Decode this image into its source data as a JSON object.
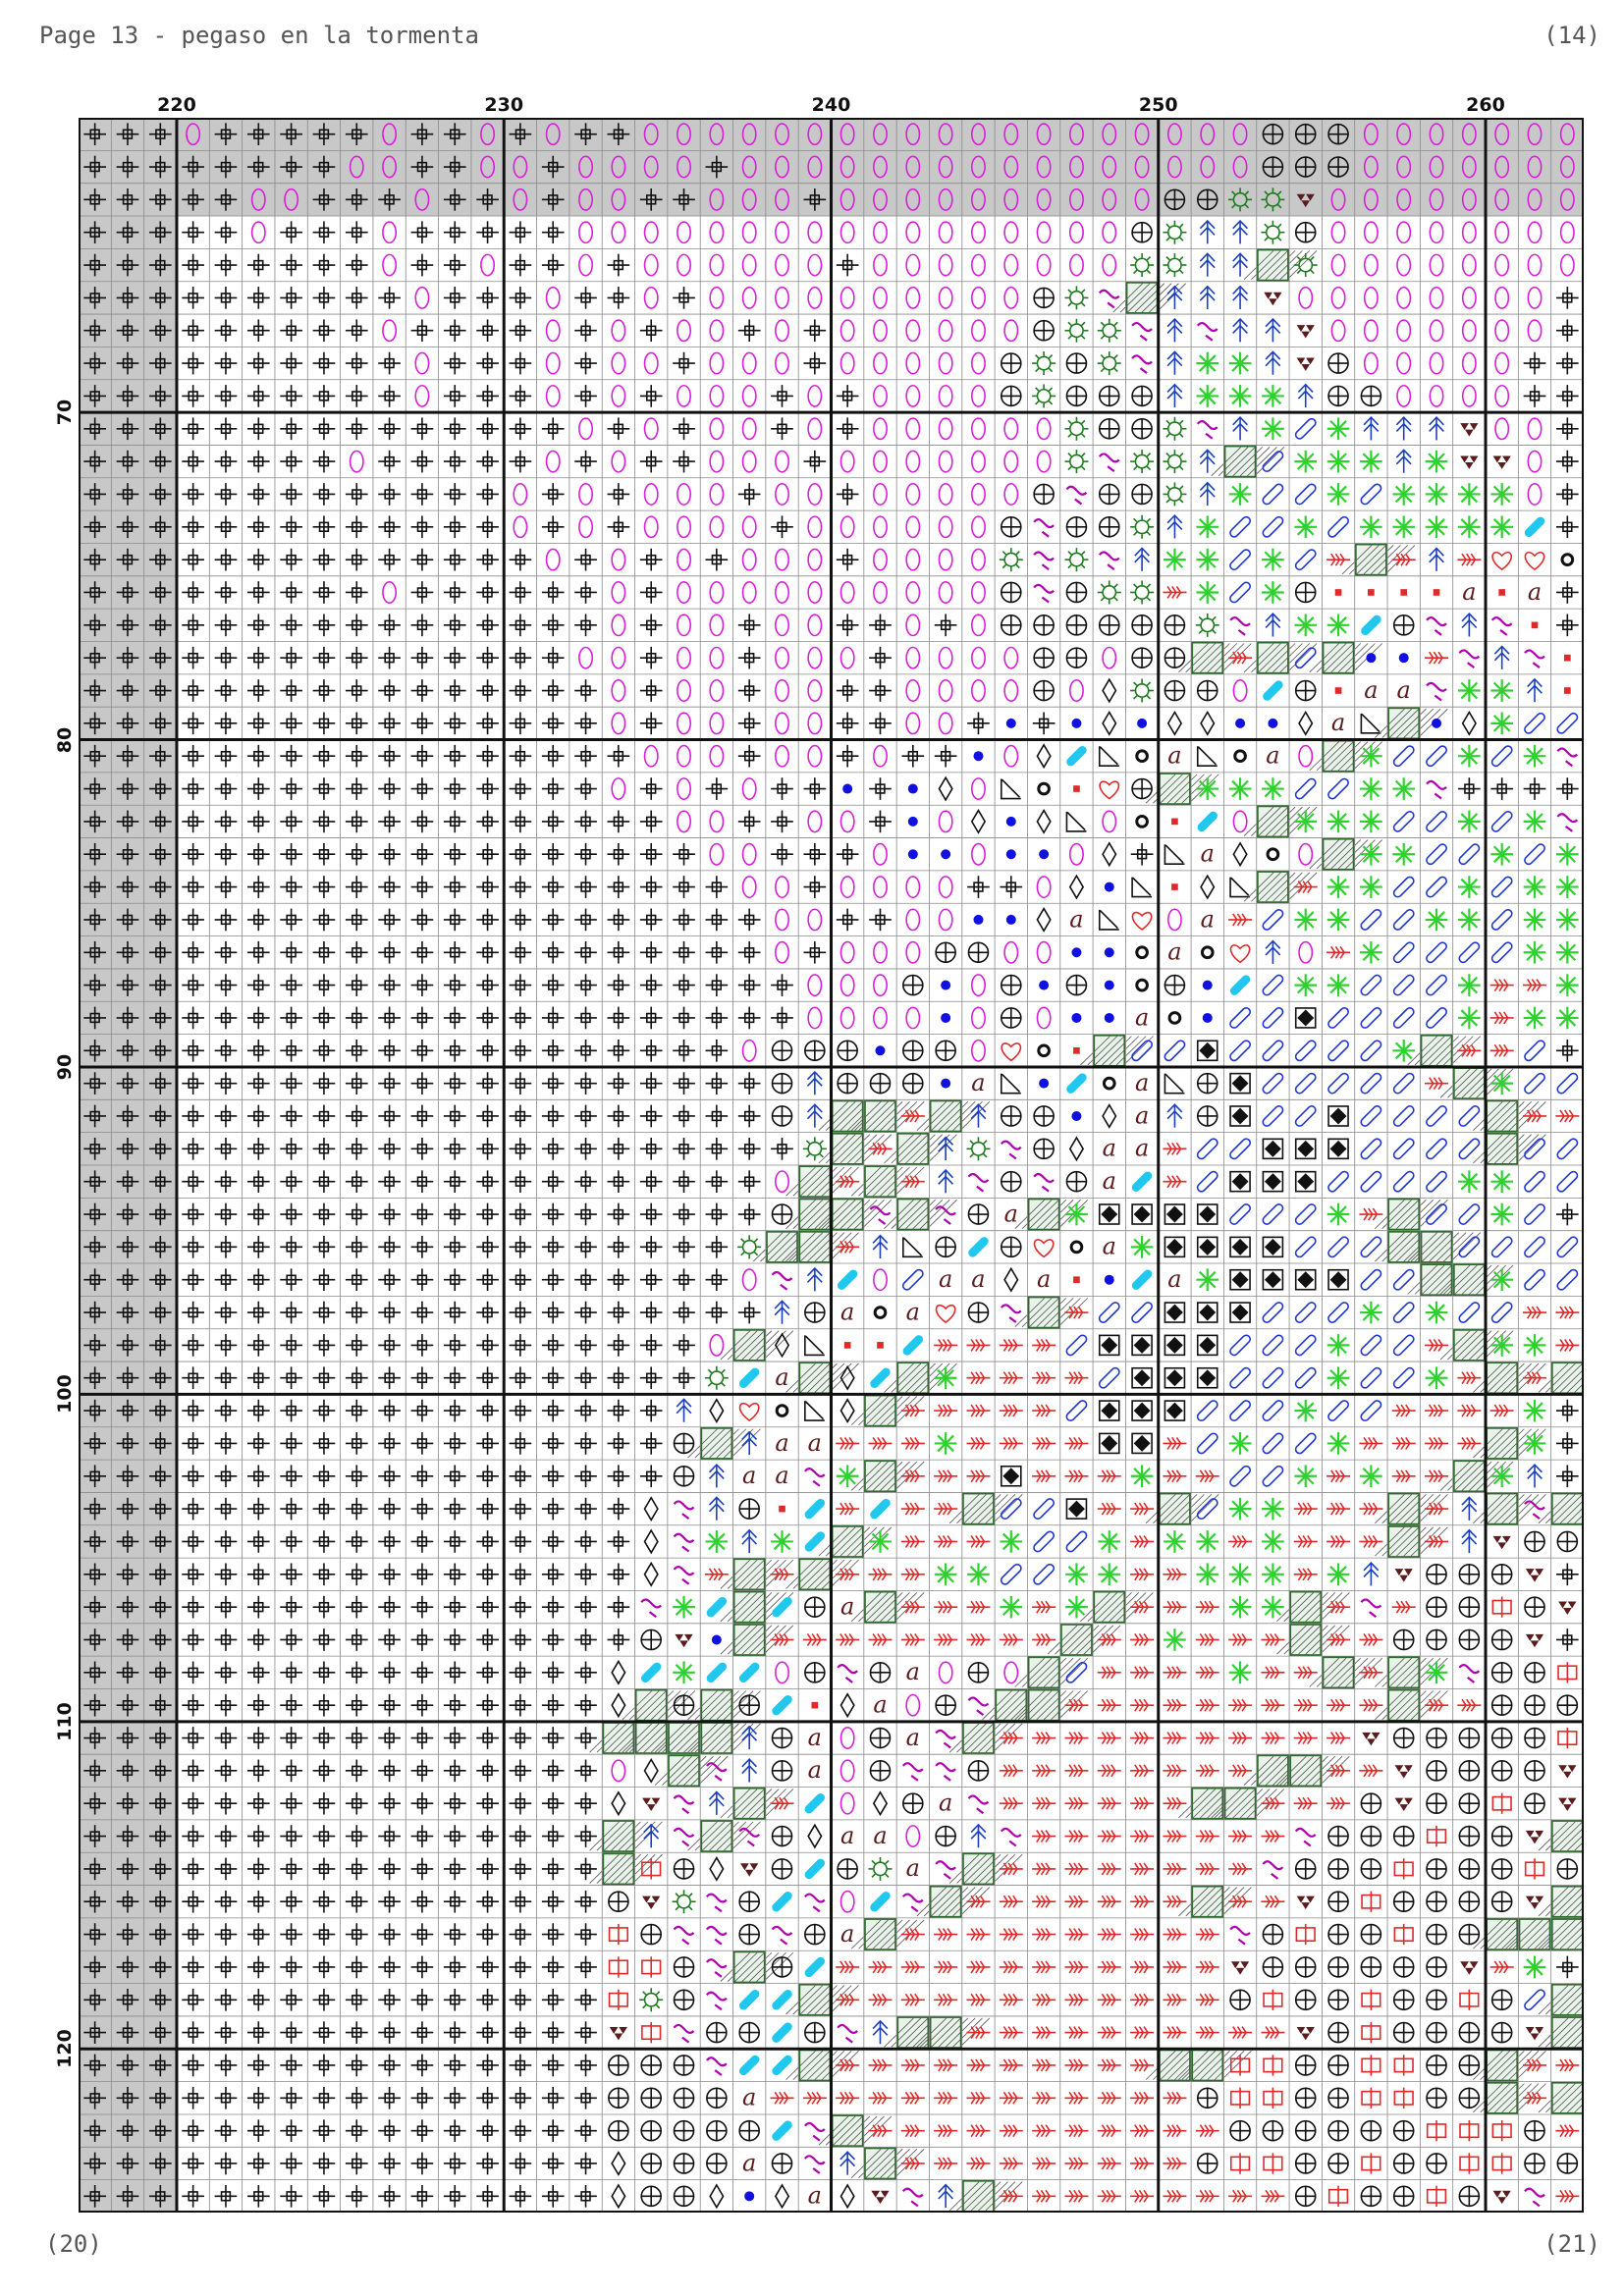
{
  "header": {
    "title": "Page 13 - pegaso en la tormenta",
    "page": "(14)"
  },
  "footer": {
    "left": "(20)",
    "right": "(21)"
  },
  "chart": {
    "first_col": 217,
    "first_row": 61,
    "ruled_rows": [
      70,
      80,
      90,
      100,
      110,
      120
    ],
    "ruled_cols": [
      220,
      230,
      240,
      250,
      260
    ],
    "labeled_cols": [
      220,
      230,
      240,
      250,
      260
    ],
    "labeled_rows": [
      70,
      80,
      90,
      100,
      110,
      120
    ],
    "gray_cols": 3,
    "gray_header_rows": 3,
    "cells": [
      "SSSoSSSSSoSSoSoSSoooooooooooooooooooPPPooooooo",
      "SSSSSSSSooSSooSooooSooooooooooooooooPPPooooooo",
      "SSSSSooSSSoSSoSooSSoooSooooooooooPPggtoooooooo",
      "SSSSSoSSSoSSSSSoooooooooooooooooPgAAgPoooooooo",
      "SSSSSSSSSoSSoSSoSooooooSooooooooggAAHgoooooooo",
      "SSSSSSSSSSoSSSoSSoSooooooooooPgsHAAAtoooooooo",
      "SSSSSSSSSoSSSSoSoSooSoSooooooPggsAsAAtooooooo",
      "SSSSSSSSSSoSSSoSooSoooSoooooPgPgsAGGAtPooooo",
      "SSSSSSSSSSoSSSoSoSoooSoSooooPgPPPAGGGAPPoooo",
      "SSSSSSSSSSSSSSSoSoSooSoSoooooogPPgsAGBGAAAtoo",
      "SSSSSSSSoSSSSSoSoSSoooSooooooogsggAHBGGGAGtto",
      "SSSSSSSSSSSSSoSoSoooSooSoooooPsPPgAGBBGBGGGGo",
      "SSSSSSSSSSSSSoSoSooooSooooooPsPPgAGBBGBGGGGGc",
      "SSSSSSSSSSSSSSoSoSoSoooSoooogsgsAGGBGBRHRARhhO",
      "SSSSSSSSSoSSSSSSoSooooooooooPsPggRGBGPmmmmama",
      "SSSSSSSSSSSSSSSSoSooSooSSoSoPPPPPPgsAGGcPsAsm",
      "SSSSSSSSSSSSSSSooSooSoooSooooPPoPPHRHBHddRsAsm",
      "SSSSSSSSSSSSSSSSoSooSooSSooooPoDgPPocPmaasGGAm",
      "SSSSSSSSSSSSSSSSoSooSooSSooSdSdDdDDddDaNHdDGBBGHc",
      "SSSSSSSSSSSSSSSSSoooSooSoSSdoDcNOaNOaoHGBBGBGs",
      "SSSSSSSSSSSSSSSSoSoSoSSdSdDoNOmhPHGGGBBGGs",
      "SSSSSSSSSSSSSSSSSSooSSooSdoDdDNoOmcoHGGGBBGBGs",
      "SSSSSSSSSSSSSSSSSSSooSSSoddoddoDSNaDOoHGGBBGBGB",
      "SSSSSSSSSSSSSSSSSSSSooSooooSSoDdNmDNHRGGBBGBGGG",
      "SSSSSSSSSSSSSSSSSSSSSooSSooddDaNhoaRBGGBBGGBGG",
      "SSSSSSSSSSSSSSSSSSSSSoSoooPPooddOaOhAoRGBBBBGGGB",
      "SSSSSSSSSSSSSSSSSSSSSSoooPdoPdPdOPdcBGGBBBGRRGB",
      "SSSSSSSSSSSSSSSSSSSSSSoooodoPoddaOdBBxBBBBGRGG",
      "SSSSSSSSSSSSSSSSSSSSoPPPdPPohOmHBBxBBBBBGHRRB",
      "SSSSSSSSSSSSSSSSSSSSSPAPPPdaNdcOaNPxBBBBBRHGBB",
      "SSSSSSSSSSSSSSSSSSSSSPAHHRHAPPdDaAPxBBxBBBBHRRG",
      "SSSSSSSSSSSSSSSSSSSSSSgHRHAgsPDaaRBBxxxBBBBHBBB",
      "SSSSSSSSSSSSSSSSSSSSSoHRHRAsPsPacRBxxxBBBBGGBBB",
      "SSSSSSSSSSSSSSSSSSSSSPHHsHsPaHGxxxxBBBGRHBBGB",
      "SSSSSSSSSSSSSSSSSSSSgHHRANPcPhOaGxxxxBBBHHBBBB",
      "SSSSSSSSSSSSSSSSSSSSosAcoBaaDamdcaGxxxxBBHHGBBG",
      "SSSSSSSSSSSSSSSSSSSSSAPaOahPsHRBBxxxBBBGBGBBRR",
      "SSSSSSSSSSSSSSSSSSSoHDNmmcRRRRBxxxxBBBGBBRHGGR",
      "SSSSSSSSSSSSSSSSSSSgcaHDcHGRRRRBxxxBBBGBBGRHRH",
      "SSSSSSSSSSSSSSSSSSADhONDHRRRRRBxxxBBBGBBRRRRG",
      "SSSSSSSSSSSSSSSSSSPHAaaRRRGRRRRxxRBGBBGRRRRHG",
      "SSSSSSSSSSSSSSSSSSPAaasGHRRRxRRRGRRBBGRGRRHGA",
      "SSSSSSSSSSSSSSSSSDsAPmcRcRRHBBxRRHBGGRRRHRAHsH",
      "SSSSSSSSSSSSSSSSSDsGAGcHGRRRGBBGRGGRGRRRHRAtPPt",
      "SSSSSSSSSSSSSSSSSDsRHRHRRRGGBBGGRRGGGRGAtPPPt",
      "SSSSSSSSSSSSSSSSSsGcHcPaHRRRGRGHRRRGGHRsRPPfPt",
      "SSSSSSSSSSSSSSSSSPtdHRRRRRRRRRHRRGRRRHRRPPPPt",
      "SSSSSSSSSSSSSSSSDcGccoPsPaoPoHBRRRRGRRHRHGsPPfPt",
      "SSSSSSSSSSSSSSSSDHPHPcmDaoPsHHRRRRRRRRRRHRRPPPP",
      "SSSSSSSSSSSSSSSSHHHHAPaoPasHRRRRRRRRRRRtPPPPPf",
      "SSSSSSSSSSSSSSSSoDHsAPaoPssPRRRRRRRRHHRRtPPPPtAH",
      "SSSSSSSSSSSSSSSSDtsAHRcoDPasRRRRRRHHRRRPtPPfPtsH",
      "SSSSSSSSSSSSSSSSHAsHsPDaaoPAsRRRRRRRRsPPPfPPtHH",
      "SSSSSSSSSSSSSSSSHfPDtPcPgasHRRRRRRRRsPPPfPPPfPt",
      "SSSSSSSSSSSSSSSSPtgsPcsocsHRRRRRRRHRRtPfPPPPtH",
      "SSSSSSSSSSSSSSSSfPssPsPaHRRRRRRRRRRsPfPPfPPHHH",
      "SSSSSSSSSSSSSSSSffPsHPcRRRRRRRRRRRRtPPPPPPtRG",
      "SSSSSSSSSSSSSSSSfgPsccHRRRRRRRRRRRRPfPPfPPfPBH",
      "SSSSSSSSSSSSSSSStfsPPcPsAHHRRRRRRRRRRtPfPPPPtHB",
      "SSSSSSSSSSSSSSSSPPPsccHRRRRRRRRRRHHffPPffPPHRR",
      "SSSSSSSSSSSSSSSSPPPPaRRRRRRRRRRRRRPffPPffPPHRH",
      "SSSSSSSSSSSSSSSSPPPPPcsHRRRRRRRRRRRPPPPPPfffPRB",
      "SSSSSSSSSSSSSSSSDPPPaPsAHRRRRRRRRRPffPPfPPffPPR",
      "SSSSSSSSSSSSSSSSDPPDdDaDtsAHRRRRRRRRRPfPPfPtsRGO"
    ]
  }
}
